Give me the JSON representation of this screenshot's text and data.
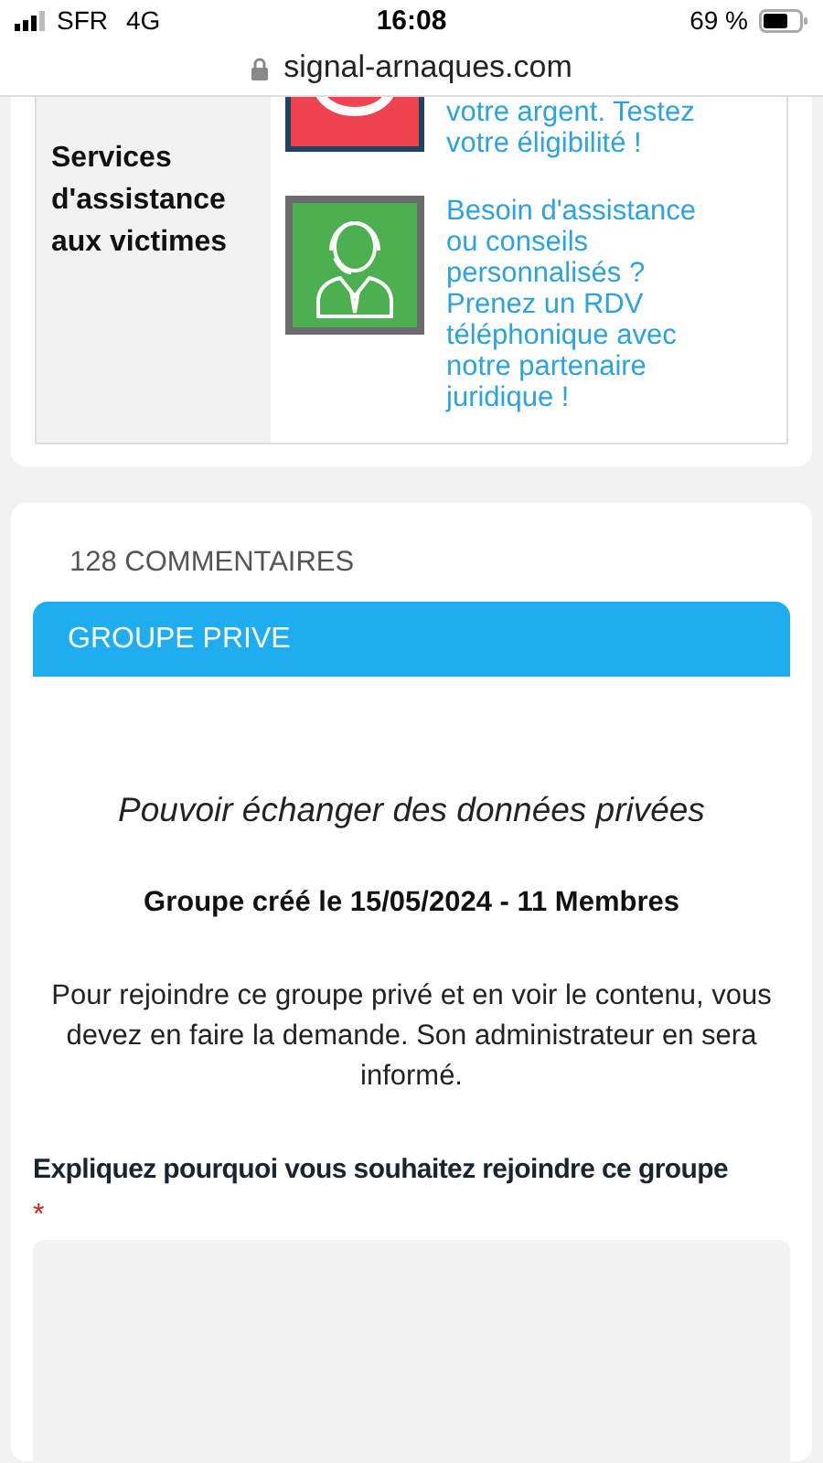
{
  "status_bar": {
    "carrier": "SFR",
    "network": "4G",
    "time": "16:08",
    "battery": "69 %"
  },
  "address_bar": {
    "url": "signal-arnaques.com"
  },
  "services": {
    "heading": "Services d'assistance aux victimes",
    "items": [
      {
        "kind": "refund",
        "text": "votre argent. Testez votre éligibilité !"
      },
      {
        "kind": "assistance",
        "text": "Besoin d'assistance ou conseils personnalisés ? Prenez un RDV téléphonique avec notre partenaire juridique !"
      }
    ]
  },
  "comments": {
    "count_label": "128 COMMENTAIRES",
    "group": {
      "header": "GROUPE PRIVE",
      "tagline": "Pouvoir échanger des données privées",
      "info": "Groupe créé le 15/05/2024 - 11 Membres",
      "description": "Pour rejoindre ce groupe privé et en voir le contenu, vous devez en faire la demande. Son administrateur en sera informé.",
      "field_label": "Expliquez pourquoi vous souhaitez rejoindre ce groupe",
      "required": true,
      "required_mark": "*"
    }
  }
}
